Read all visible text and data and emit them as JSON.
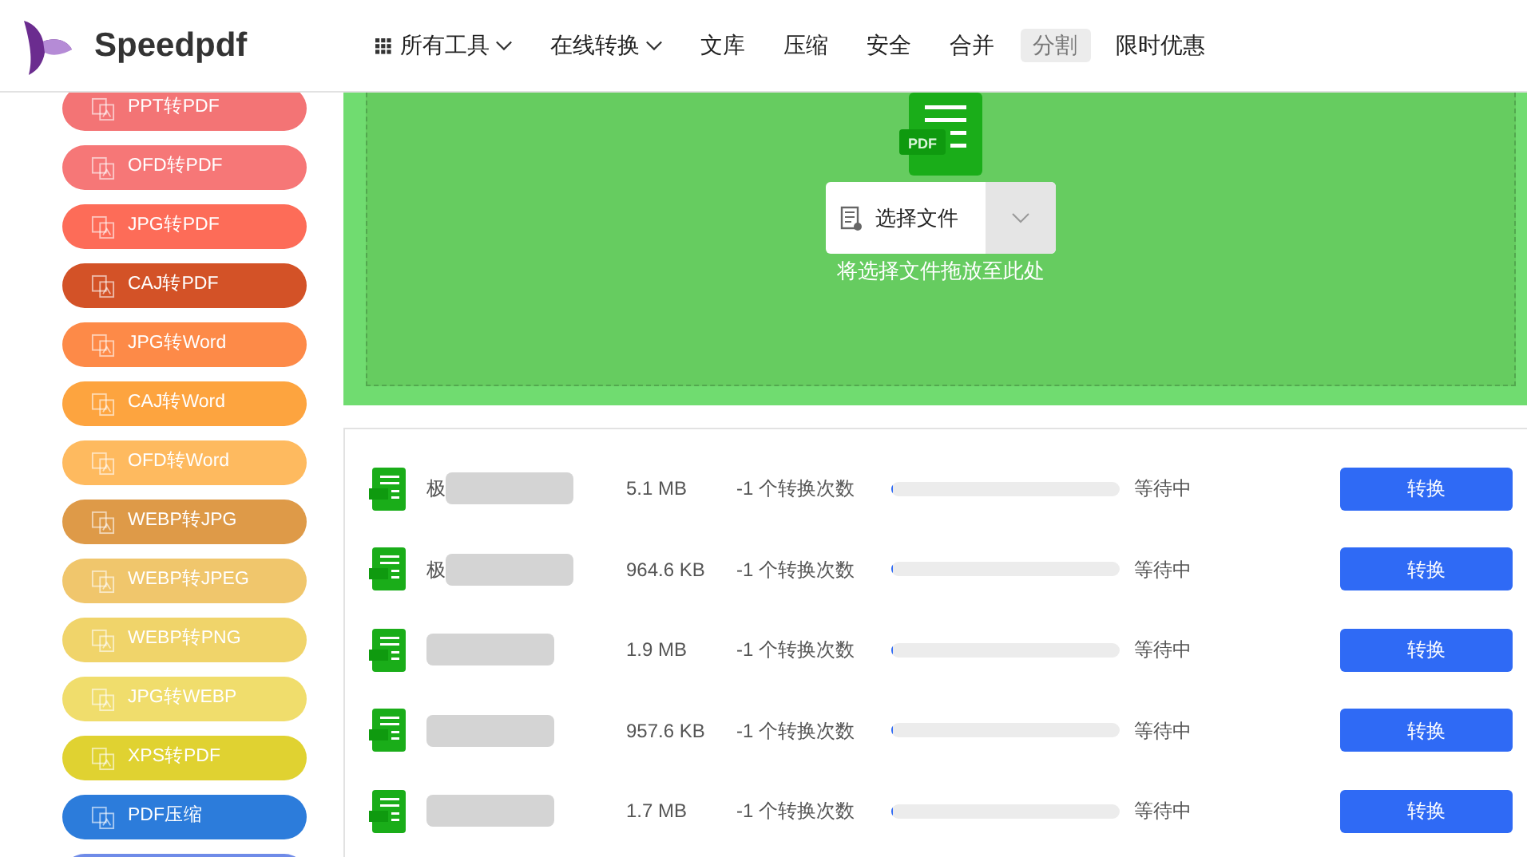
{
  "header": {
    "logo": "Speedpdf",
    "nav": [
      {
        "label": "所有工具",
        "kind": "grid-dropdown",
        "selected": false
      },
      {
        "label": "在线转换",
        "kind": "dropdown",
        "selected": false
      },
      {
        "label": "文库",
        "kind": "link",
        "selected": false
      },
      {
        "label": "压缩",
        "kind": "link",
        "selected": false
      },
      {
        "label": "安全",
        "kind": "link",
        "selected": false
      },
      {
        "label": "合并",
        "kind": "link",
        "selected": false
      },
      {
        "label": "分割",
        "kind": "link",
        "selected": true
      },
      {
        "label": "限时优惠",
        "kind": "link",
        "selected": false
      }
    ]
  },
  "sidebar": {
    "items": [
      {
        "label": "PPT转PDF",
        "color": "#f37475"
      },
      {
        "label": "OFD转PDF",
        "color": "#f67777"
      },
      {
        "label": "JPG转PDF",
        "color": "#fd6c58"
      },
      {
        "label": "CAJ转PDF",
        "color": "#d35227"
      },
      {
        "label": "JPG转Word",
        "color": "#fd8a48"
      },
      {
        "label": "CAJ转Word",
        "color": "#fda43f"
      },
      {
        "label": "OFD转Word",
        "color": "#feba5f"
      },
      {
        "label": "WEBP转JPG",
        "color": "#de9a48"
      },
      {
        "label": "WEBP转JPEG",
        "color": "#f0c66c"
      },
      {
        "label": "WEBP转PNG",
        "color": "#f0d46a"
      },
      {
        "label": "JPG转WEBP",
        "color": "#f0dd6c"
      },
      {
        "label": "XPS转PDF",
        "color": "#e0d231"
      },
      {
        "label": "PDF压缩",
        "color": "#2c7cdb"
      },
      {
        "color": "#6f8be8"
      }
    ]
  },
  "upload": {
    "icon_label": "PDF",
    "button": "选择文件",
    "hint": "将选择文件拖放至此处"
  },
  "files": [
    {
      "name": "极",
      "size": "5.1 MB",
      "count": "-1 个转换次数",
      "level": 0,
      "status": "等待中",
      "action": "转换"
    },
    {
      "name": "极",
      "size": "964.6 KB",
      "count": "-1 个转换次数",
      "level": 0,
      "status": "等待中",
      "action": "转换"
    },
    {
      "size": "1.9 MB",
      "count": "-1 个转换次数",
      "level": 0,
      "status": "等待中",
      "action": "转换"
    },
    {
      "size": "957.6 KB",
      "count": "-1 个转换次数",
      "level": 0,
      "status": "等待中",
      "action": "转换"
    },
    {
      "size": "1.7 MB",
      "count": "-1 个转换次数",
      "level": 0,
      "status": "等待中",
      "action": "转换"
    }
  ]
}
